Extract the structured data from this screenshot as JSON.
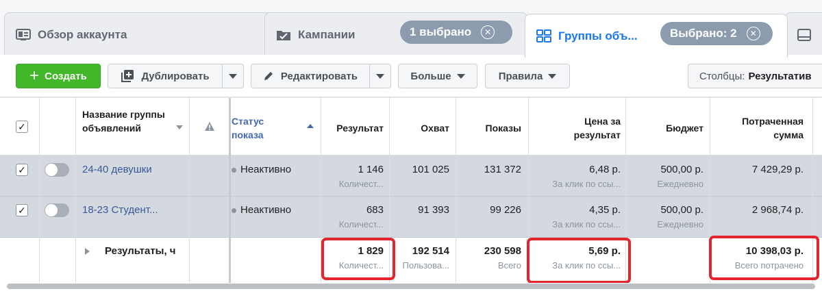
{
  "tabs": {
    "account": {
      "label": "Обзор аккаунта"
    },
    "campaigns": {
      "label": "Кампании",
      "badge": "1 выбрано"
    },
    "adsets": {
      "label": "Группы объ...",
      "badge": "Выбрано: 2"
    }
  },
  "toolbar": {
    "create": "Создать",
    "duplicate": "Дублировать",
    "edit": "Редактировать",
    "more": "Больше",
    "rules": "Правила",
    "columns_prefix": "Столбцы:",
    "columns_value": "Результатив"
  },
  "table": {
    "headers": {
      "name": "Название группы объявлений",
      "status": "Статус показа",
      "results": "Результат",
      "reach": "Охват",
      "impressions": "Показы",
      "cost": "Цена за результат",
      "budget": "Бюджет",
      "spent": "Потраченная сумма"
    },
    "rows": [
      {
        "name": "24-40 девушки",
        "status": "Неактивно",
        "results": "1 146",
        "results_sub": "Количест...",
        "reach": "101 025",
        "impressions": "131 372",
        "cost": "6,48 р.",
        "cost_sub": "За клик по ссы...",
        "budget": "500,00 р.",
        "budget_sub": "Ежедневно",
        "spent": "7 429,29 р."
      },
      {
        "name": "18-23 Студент...",
        "status": "Неактивно",
        "results": "683",
        "results_sub": "Количест...",
        "reach": "91 393",
        "impressions": "99 226",
        "cost": "4,35 р.",
        "cost_sub": "За клик по ссы...",
        "budget": "500,00 р.",
        "budget_sub": "Ежедневно",
        "spent": "2 968,74 р."
      }
    ],
    "totals": {
      "label": "Результаты, ч",
      "results": "1 829",
      "results_sub": "Количест...",
      "reach": "192 514",
      "reach_sub": "Пользова...",
      "impressions": "230 598",
      "impressions_sub": "Всего",
      "cost": "5,69 р.",
      "cost_sub": "За клик по ссы...",
      "spent": "10 398,03 р.",
      "spent_sub": "Всего потрачено"
    }
  },
  "colors": {
    "accent": "#1877f2",
    "create_button": "#42b72a",
    "highlight": "#e3262e",
    "selected_row": "#d4d9e0",
    "badge": "#8d9bae"
  },
  "icons": [
    "account-overview-icon",
    "campaign-folder-icon",
    "adsets-grid-icon",
    "ads-icon",
    "plus-icon",
    "duplicate-icon",
    "pencil-icon",
    "caret-down-icon",
    "warning-icon",
    "sort-up-icon",
    "close-circle-icon",
    "expand-arrow-icon"
  ]
}
